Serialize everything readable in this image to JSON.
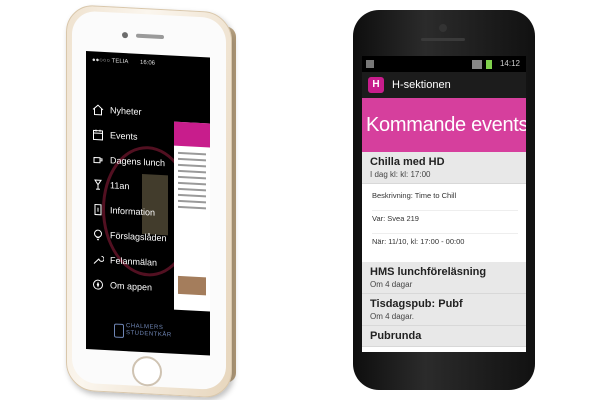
{
  "iphone": {
    "status": {
      "carrier": "●●○○○ TELIA",
      "time": "16:06"
    },
    "menu": [
      {
        "label": "Nyheter",
        "icon": "home-icon"
      },
      {
        "label": "Events",
        "icon": "calendar-icon"
      },
      {
        "label": "Dagens lunch",
        "icon": "coffee-cup-icon"
      },
      {
        "label": "11an",
        "icon": "drink-glass-icon"
      },
      {
        "label": "Information",
        "icon": "info-icon"
      },
      {
        "label": "Förslagslåden",
        "icon": "lightbulb-icon"
      },
      {
        "label": "Felanmälan",
        "icon": "wrench-icon"
      },
      {
        "label": "Om appen",
        "icon": "compass-icon"
      }
    ],
    "logo": {
      "line1": "CHALMERS",
      "line2": "STUDENTKÅR"
    }
  },
  "android": {
    "status": {
      "time": "14:12"
    },
    "app_title": "H-sektionen",
    "app_icon_letter": "H",
    "banner_title": "Kommande events",
    "events": [
      {
        "title": "Chilla med HD",
        "subtitle": "I dag kl: kl: 17:00",
        "details": [
          "Beskrivning: Time to Chill",
          "Var: Svea 219",
          "När: 11/10, kl: 17:00 - 00:00"
        ]
      },
      {
        "title": "HMS lunchföreläsning",
        "subtitle": "Om 4 dagar"
      },
      {
        "title": "Tisdagspub: Pubf",
        "subtitle": "Om 4 dagar."
      },
      {
        "title": "Pubrunda",
        "subtitle": ""
      }
    ]
  },
  "colors": {
    "accent_magenta": "#d63f9d",
    "action_bar": "#1c1c1c",
    "ios_background": "#000000"
  }
}
